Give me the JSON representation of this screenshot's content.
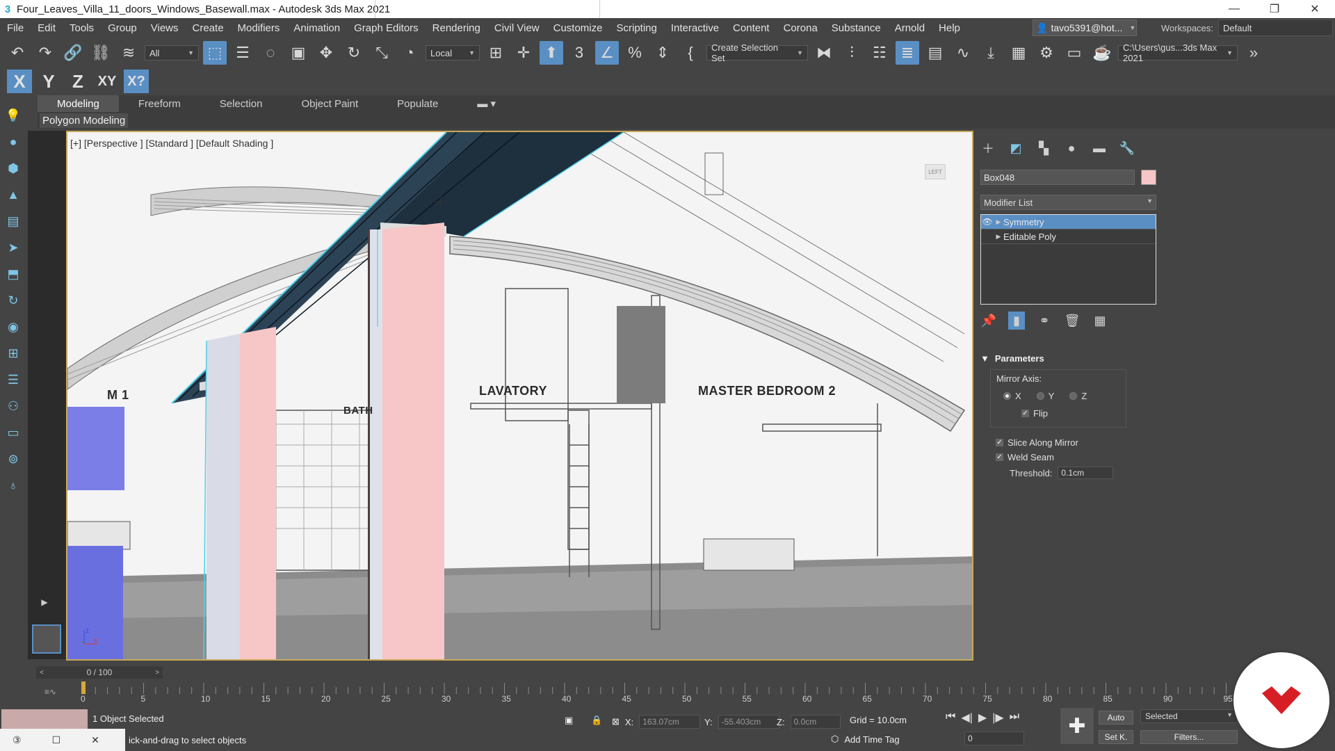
{
  "titlebar": {
    "title": "Four_Leaves_Villa_11_doors_Windows_Basewall.max - Autodesk 3ds Max 2021",
    "minimize": "—",
    "restore": "❐",
    "close": "✕"
  },
  "menu": {
    "items": [
      "File",
      "Edit",
      "Tools",
      "Group",
      "Views",
      "Create",
      "Modifiers",
      "Animation",
      "Graph Editors",
      "Rendering",
      "Civil View",
      "Customize",
      "Scripting",
      "Interactive",
      "Content",
      "Corona",
      "Substance",
      "Arnold",
      "Help"
    ],
    "user": "tavo5391@hot...",
    "workspaces_label": "Workspaces:",
    "workspace_value": "Default"
  },
  "toolbar": {
    "filter_value": "All",
    "coord_value": "Local",
    "selection_set_placeholder": "Create Selection Set",
    "project_path": "C:\\Users\\gus...3ds Max 2021"
  },
  "axis": {
    "x": "X",
    "y": "Y",
    "z": "Z",
    "xy": "XY",
    "xq": "X?"
  },
  "ribbon": {
    "tabs": [
      "Modeling",
      "Freeform",
      "Selection",
      "Object Paint",
      "Populate"
    ],
    "active_tab": "Modeling",
    "sub_label": "Polygon Modeling"
  },
  "viewport": {
    "label": "[+] [Perspective ] [Standard ] [Default Shading ]",
    "viewcube_text": "LEFT",
    "rooms": {
      "room1": "M 1",
      "bath": "BATH",
      "lavatory": "LAVATORY",
      "master_bedroom": "MASTER BEDROOM 2"
    }
  },
  "command_panel": {
    "object_name": "Box048",
    "object_color": "#f7c6c6",
    "modifier_list": "Modifier List",
    "stack": [
      {
        "label": "Symmetry",
        "selected": true
      },
      {
        "label": "Editable Poly",
        "selected": false
      }
    ],
    "parameters": {
      "title": "Parameters",
      "mirror_axis_label": "Mirror Axis:",
      "axes": [
        {
          "label": "X",
          "on": true
        },
        {
          "label": "Y",
          "on": false
        },
        {
          "label": "Z",
          "on": false
        }
      ],
      "flip_label": "Flip",
      "slice_label": "Slice Along Mirror",
      "weld_label": "Weld Seam",
      "threshold_label": "Threshold:",
      "threshold_value": "0.1cm"
    }
  },
  "timeline": {
    "frame_display": "0 / 100",
    "ticks": [
      "0",
      "5",
      "10",
      "15",
      "20",
      "25",
      "30",
      "35",
      "40",
      "45",
      "50",
      "55",
      "60",
      "65",
      "70",
      "75",
      "80",
      "85",
      "90",
      "95"
    ]
  },
  "status": {
    "selection": "1 Object Selected",
    "prompt": "ick-and-drag to select objects",
    "x_label": "X:",
    "x_value": "163.07cm",
    "y_label": "Y:",
    "y_value": "-55.403cm",
    "z_label": "Z:",
    "z_value": "0.0cm",
    "grid": "Grid = 10.0cm",
    "add_time_tag": "Add Time Tag",
    "frame_value": "0",
    "auto_label": "Auto",
    "setk_label": "Set K.",
    "selected_value": "Selected",
    "filters_label": "Filters..."
  },
  "colors": {
    "accent": "#5a8fc4",
    "viewport_border": "#c9a85b",
    "beam": "#1e2f3e",
    "column_pink": "#f7c6c6",
    "selection_edge": "#4fd0e8",
    "brand_red": "#d81e25"
  }
}
